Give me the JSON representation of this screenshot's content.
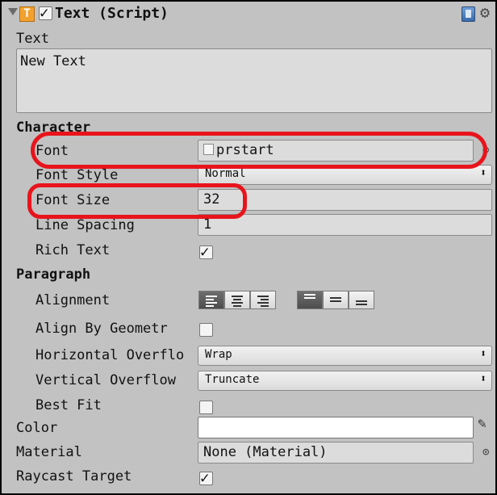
{
  "component": {
    "title": "Text (Script)",
    "enabled": true,
    "type_icon_letter": "T"
  },
  "text_section": {
    "label": "Text",
    "value": "New Text"
  },
  "character": {
    "heading": "Character",
    "font_label": "Font",
    "font_value": "prstart",
    "font_style_label": "Font Style",
    "font_style_value": "Normal",
    "font_size_label": "Font Size",
    "font_size_value": "32",
    "line_spacing_label": "Line Spacing",
    "line_spacing_value": "1",
    "rich_text_label": "Rich Text",
    "rich_text_checked": true
  },
  "paragraph": {
    "heading": "Paragraph",
    "alignment_label": "Alignment",
    "horizontal_alignment_selected": "left",
    "vertical_alignment_selected": "top",
    "align_geometry_label": "Align By Geometr",
    "align_geometry_checked": false,
    "horizontal_overflow_label": "Horizontal Overflo",
    "horizontal_overflow_value": "Wrap",
    "vertical_overflow_label": "Vertical Overflow",
    "vertical_overflow_value": "Truncate",
    "best_fit_label": "Best Fit",
    "best_fit_checked": false
  },
  "color_label": "Color",
  "color_value": "#ffffff",
  "material_label": "Material",
  "material_value": "None (Material)",
  "raycast_label": "Raycast Target",
  "raycast_checked": true,
  "dropdown_arrow": "⬍",
  "highlight_color": "#e8141c",
  "icons": [
    "foldout-arrow-icon",
    "text-component-icon",
    "help-book-icon",
    "gear-icon",
    "font-asset-icon",
    "object-picker-icon",
    "eyedropper-icon"
  ]
}
